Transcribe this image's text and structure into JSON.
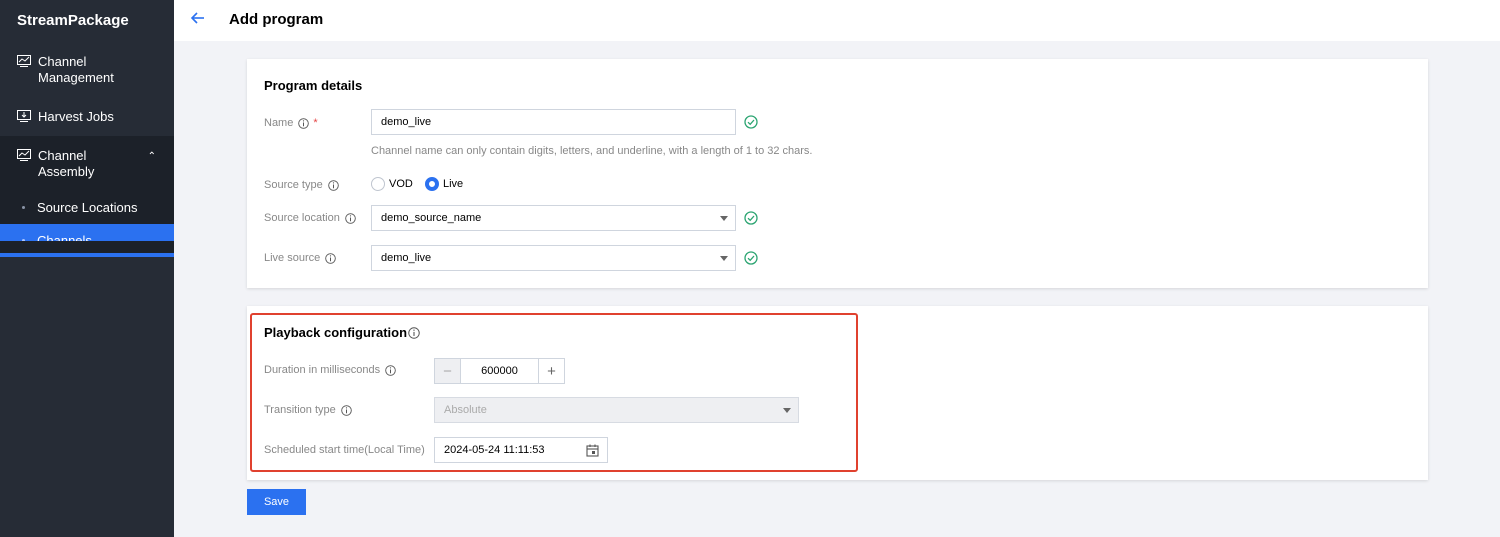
{
  "app": {
    "brand": "StreamPackage"
  },
  "sidebar": {
    "items": [
      {
        "label": "Channel\nManagement",
        "icon": "monitor-chart-icon"
      },
      {
        "label": "Harvest Jobs",
        "icon": "download-monitor-icon"
      },
      {
        "label": "Channel\nAssembly",
        "icon": "monitor-chart-icon",
        "expanded": true
      }
    ],
    "sub_items": [
      {
        "label": "Source Locations",
        "active": false
      },
      {
        "label": "Channels",
        "active": true
      }
    ]
  },
  "header": {
    "title": "Add program",
    "back_icon": "arrow-left-icon"
  },
  "program_details": {
    "title": "Program details",
    "name": {
      "label": "Name",
      "value": "demo_live",
      "hint": "Channel name can only contain digits, letters, and underline, with a length of 1 to 32 chars.",
      "required_mark": "*"
    },
    "source_type": {
      "label": "Source type",
      "options": [
        "VOD",
        "Live"
      ],
      "selected": "Live"
    },
    "source_location": {
      "label": "Source location",
      "value": "demo_source_name"
    },
    "live_source": {
      "label": "Live source",
      "value": "demo_live"
    }
  },
  "playback": {
    "title": "Playback configuration",
    "duration": {
      "label": "Duration in milliseconds",
      "value": "600000",
      "minus": "−",
      "plus": "+"
    },
    "transition_type": {
      "label": "Transition type",
      "value": "Absolute"
    },
    "start_time": {
      "label": "Scheduled start time(Local Time)",
      "value": "2024-05-24 11:11:53"
    }
  },
  "actions": {
    "save_label": "Save"
  },
  "colors": {
    "accent": "#2b71f0",
    "sidebar_bg": "#262c36",
    "success": "#2ba471",
    "highlight": "#e0412f"
  }
}
